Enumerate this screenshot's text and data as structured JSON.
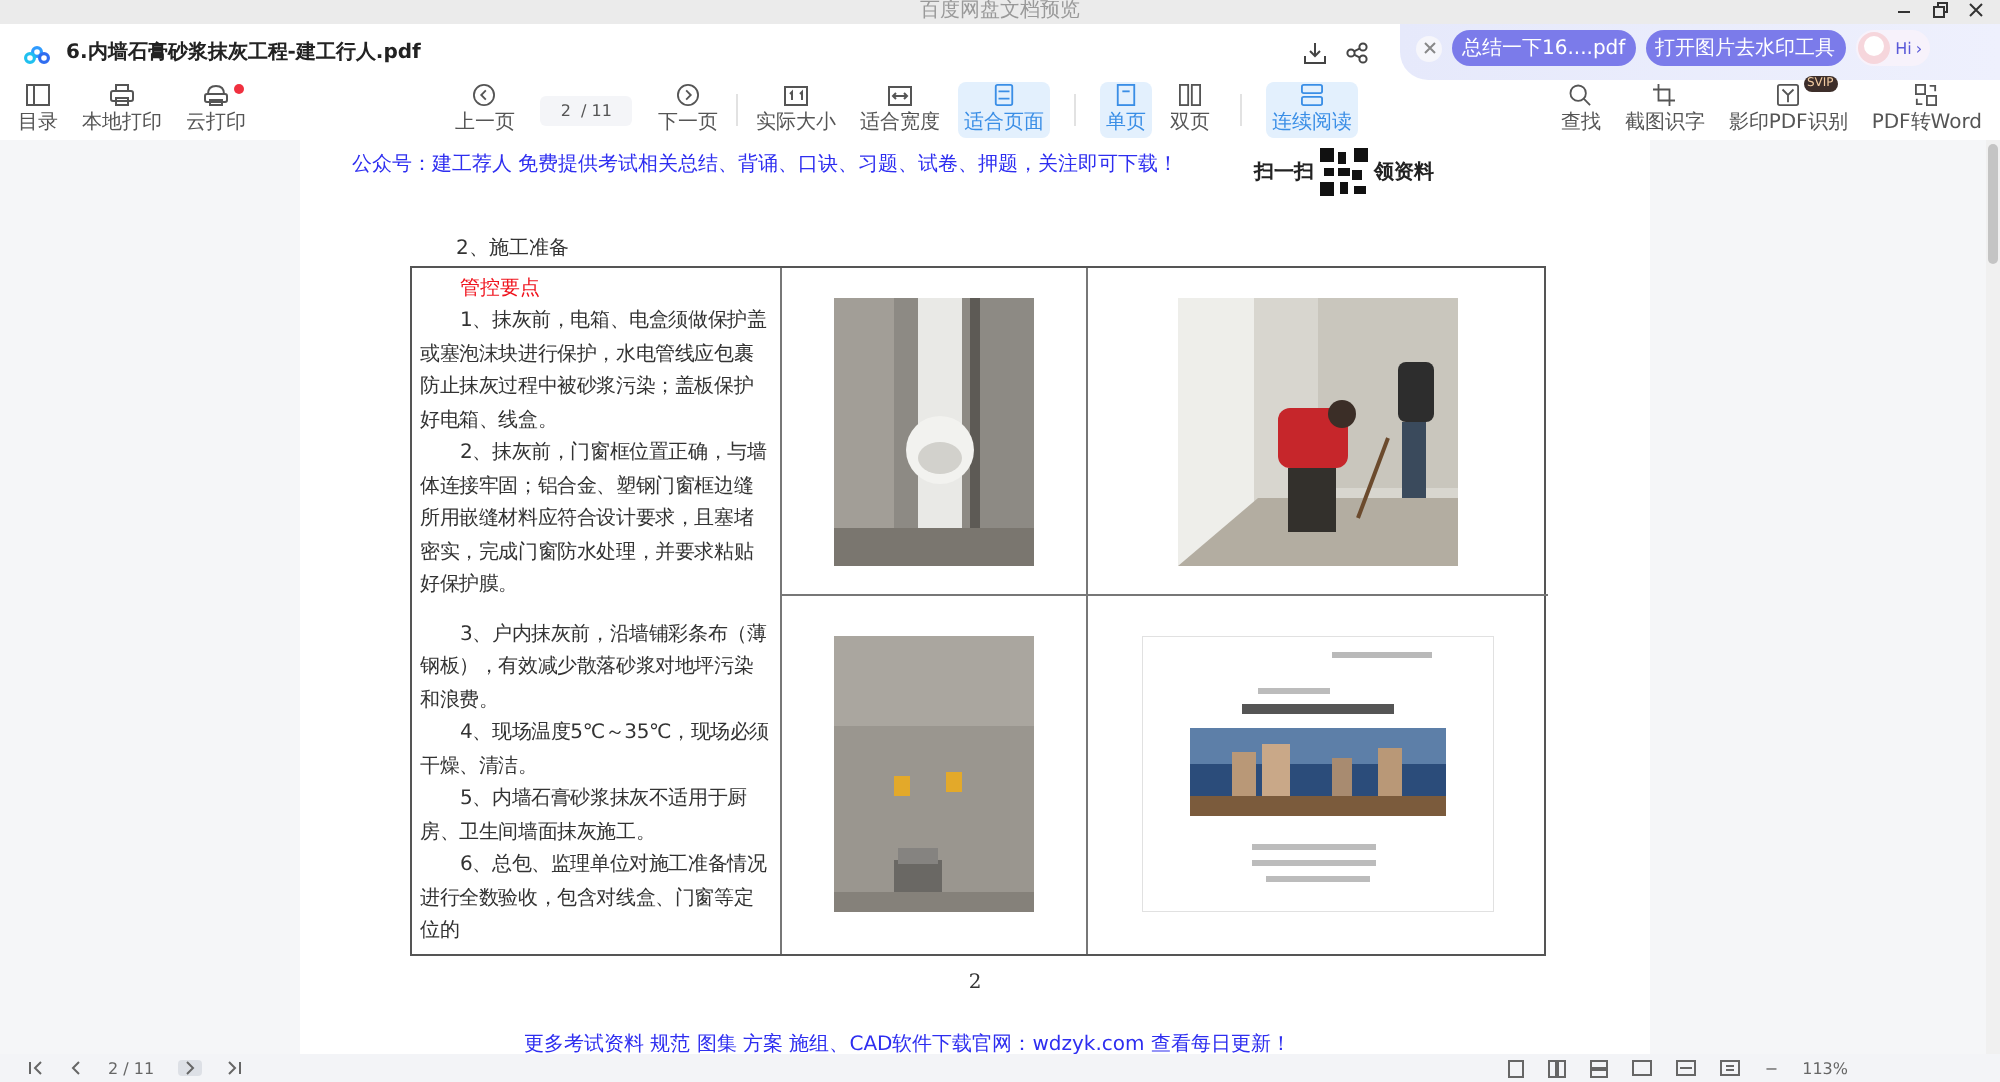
{
  "window": {
    "title": "百度网盘文档预览"
  },
  "file": {
    "name": "6.内墙石膏砂浆抹灰工程-建工行人.pdf"
  },
  "assistant": {
    "chips": [
      "总结一下16....pdf",
      "打开图片去水印工具"
    ],
    "greeting": "Hi",
    "arrow": "›"
  },
  "toolbar": {
    "left": [
      {
        "label": "目录",
        "notification": false
      },
      {
        "label": "本地打印",
        "notification": false
      },
      {
        "label": "云打印",
        "notification": true
      }
    ],
    "nav": {
      "prev": "上一页",
      "page": "2",
      "total": "/ 11",
      "next": "下一页"
    },
    "view": [
      {
        "label": "实际大小",
        "selected": false
      },
      {
        "label": "适合宽度",
        "selected": false
      },
      {
        "label": "适合页面",
        "selected": true
      },
      {
        "label": "单页",
        "selected": true
      },
      {
        "label": "双页",
        "selected": false
      },
      {
        "label": "连续阅读",
        "selected": true
      }
    ],
    "tools": [
      {
        "label": "查找"
      },
      {
        "label": "截图识字"
      },
      {
        "label": "影印PDF识别",
        "badge": "SVIP"
      },
      {
        "label": "PDF转Word"
      }
    ]
  },
  "document": {
    "header": "公众号：建工荐人 免费提供考试相关总结、背诵、口诀、习题、试卷、押题，关注即可下载！",
    "qr_left": "扫一扫",
    "qr_right": "领资料",
    "section": "2、施工准备",
    "table": {
      "heading": "管控要点",
      "paragraph_groups": [
        [
          "1、抹灰前，电箱、电盒须做保护盖或塞泡沫块进行保护，水电管线应包裹防止抹灰过程中被砂浆污染；盖板保护好电箱、线盒。",
          "2、抹灰前，门窗框位置正确，与墙体连接牢固；铝合金、塑钢门窗框边缝所用嵌缝材料应符合设计要求，且塞堵密实，完成门窗防水处理，并要求粘贴好保护膜。"
        ],
        [
          "3、户内抹灰前，沿墙铺彩条布（薄钢板），有效减少散落砂浆对地坪污染和浪费。",
          "4、现场温度5℃～35℃，现场必须干燥、清洁。",
          "5、内墙石膏砂浆抹灰不适用于厨房、卫生间墙面抹灰施工。",
          "6、总包、监理单位对施工准备情况进行全数验收，包含对线盒、门窗等定位的"
        ]
      ],
      "pictures": [
        {
          "kind": "pipe"
        },
        {
          "kind": "worker"
        },
        {
          "kind": "wall"
        },
        {
          "kind": "document"
        }
      ]
    },
    "page_number": "2",
    "footer": "更多考试资料 规范 图集 方案 施组、CAD软件下载官网：wdzyk.com 查看每日更新！"
  },
  "status_bar": {
    "page": "2 / 11",
    "zoom": "113%",
    "zoom_out": "−"
  }
}
